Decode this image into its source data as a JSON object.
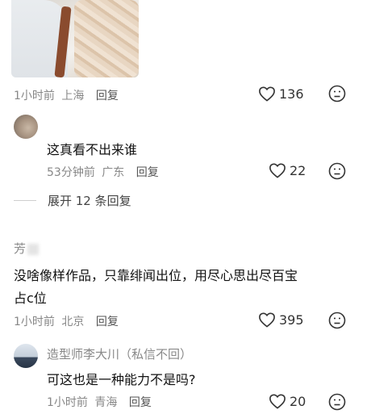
{
  "comment1": {
    "time": "1小时前",
    "location": "上海",
    "reply_label": "回复",
    "likes": "136"
  },
  "reply1": {
    "text": "这真看不出来谁",
    "time": "53分钟前",
    "location": "广东",
    "reply_label": "回复",
    "likes": "22"
  },
  "expand_replies": "展开 12 条回复",
  "comment2": {
    "username": "芳",
    "text_line1": "没啥像样作品，只靠绯闻出位，用尽心思出尽百宝",
    "text_line2": "占c位",
    "time": "1小时前",
    "location": "北京",
    "reply_label": "回复",
    "likes": "395"
  },
  "reply2": {
    "username": "造型师李大川（私信不回）",
    "text": "可这也是一种能力不是吗?",
    "time": "1小时前",
    "location": "青海",
    "reply_label": "回复",
    "likes": "20"
  },
  "icons": {
    "like": "heart-outline-icon",
    "dislike": "frown-face-icon"
  },
  "colors": {
    "meta_text": "#888888",
    "body_text": "#111111"
  }
}
